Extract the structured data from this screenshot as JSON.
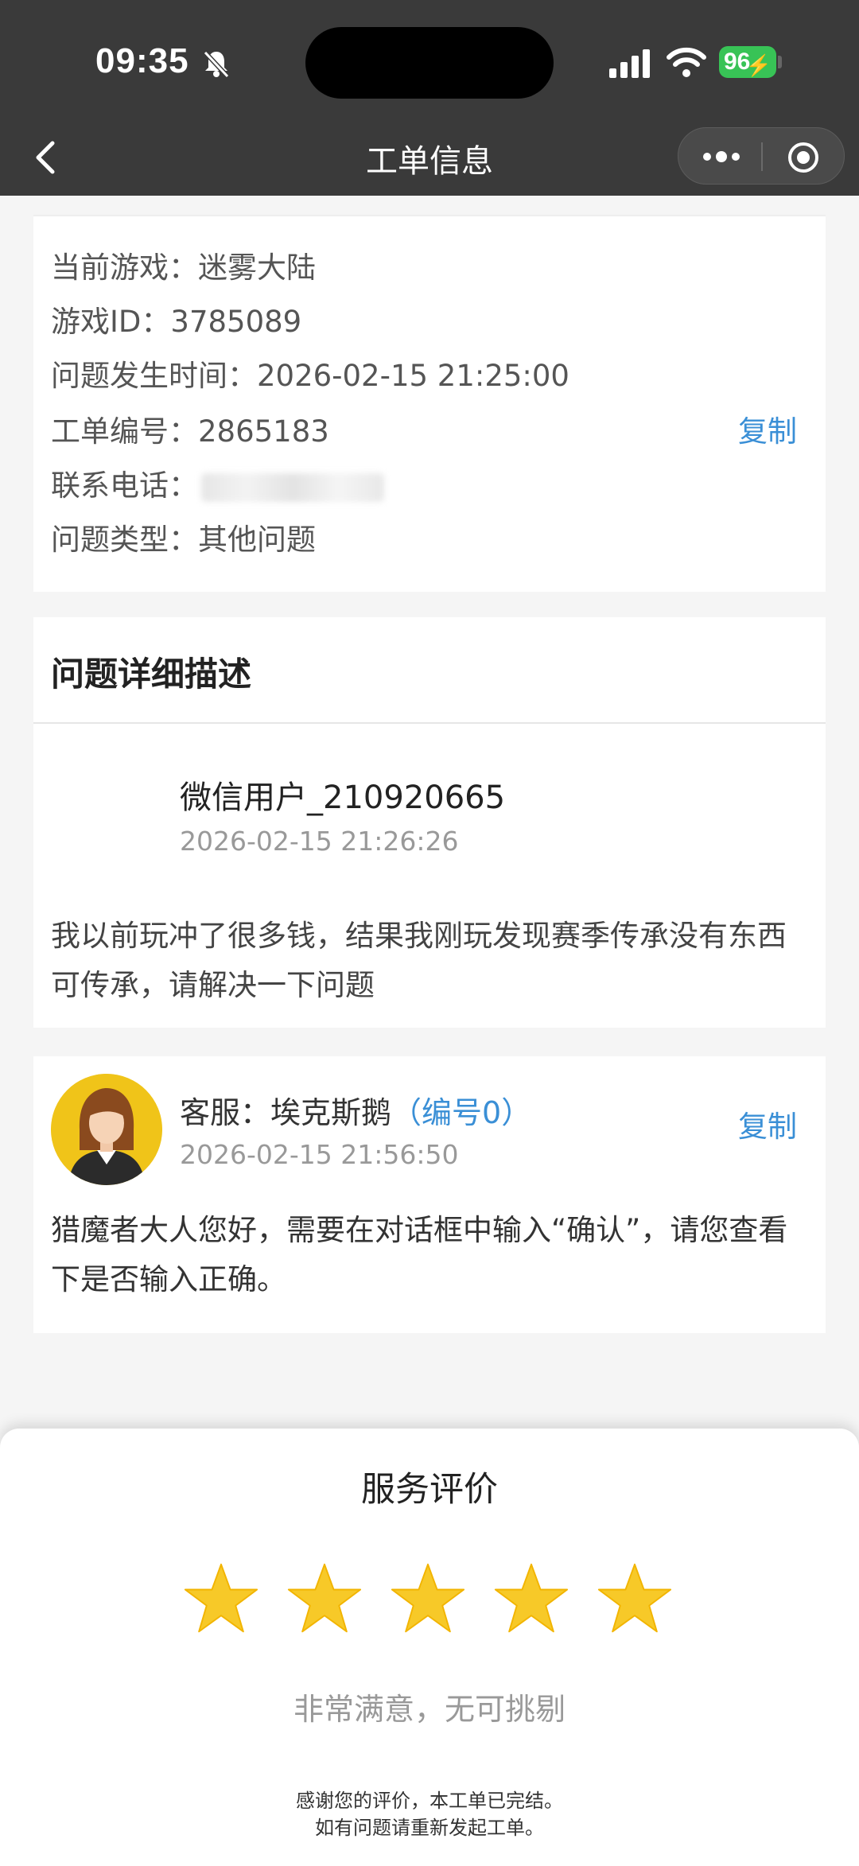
{
  "status_bar": {
    "time": "09:35",
    "battery": "96"
  },
  "nav": {
    "title": "工单信息"
  },
  "info": {
    "game": "当前游戏：迷雾大陆",
    "game_id": "游戏ID：3785089",
    "issue_time": "问题发生时间：2026-02-15 21:25:00",
    "ticket_no": "工单编号：2865183",
    "copy_label": "复制",
    "phone_label": "联系电话：",
    "issue_type": "问题类型：其他问题"
  },
  "description": {
    "header": "问题详细描述",
    "user_name": "微信用户_210920665",
    "user_time": "2026-02-15 21:26:26",
    "message": "我以前玩冲了很多钱，结果我刚玩发现赛季传承没有东西可传承，请解决一下问题"
  },
  "reply": {
    "agent_label": "客服：埃克斯鹅",
    "agent_id": "（编号0）",
    "copy_label": "复制",
    "time": "2026-02-15 21:56:50",
    "message": "猎魔者大人您好，需要在对话框中输入“确认”，请您查看下是否输入正确。"
  },
  "rating": {
    "title": "服务评价",
    "stars": 5,
    "max_stars": 5,
    "verdict": "非常满意，无可挑剔",
    "thanks_line1": "感谢您的评价，本工单已完结。",
    "thanks_line2": "如有问题请重新发起工单。"
  },
  "colors": {
    "header_bg": "#3a3a3a",
    "link": "#3a8fd6",
    "battery": "#38c356",
    "star": "#f7c928",
    "avatar_bg": "#f0c419"
  }
}
